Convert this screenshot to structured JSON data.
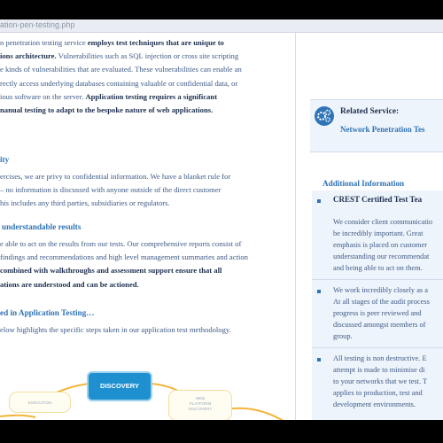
{
  "browser": {
    "url": "ation-pen-testing.php"
  },
  "main": {
    "intro": {
      "t1": "n penetration testing service ",
      "b1": "employs test techniques that are unique to",
      "b2": "ions architecture.",
      "t2": " Vulnerabilities such as SQL injection or cross site scripting",
      "l3": "e kinds of vulnerabilities that are evaluated. These vulnerabilities can enable an",
      "l4": "rectly access underlying databases containing valuable or confidential data, or",
      "l5a": "ious software on the server. ",
      "b5": "Application testing requires a significant",
      "b6": "nanual testing to adapt to the bespoke nature of web applications."
    },
    "confidentiality": {
      "heading": "ity",
      "l1": "ercises, we are privy to confidential information. We have a blanket rule for",
      "l2": " – no information is discussed with anyone outside of the direct customer",
      "l3": "his includes any third parties, subsidiaries or regulators."
    },
    "results": {
      "heading": "understandable results",
      "l1": "e able to act on the results from our tests. Our comprehensive reports consist of",
      "l2": "findings and recommendations and high level management summaries and action",
      "b3": "combined with walkthroughs and assessment support ensure that all",
      "b4": "ations are understood and can be actioned."
    },
    "steps": {
      "heading": "ed in Application Testing…",
      "l1": "elow highlights the specific steps taken in our application test methodology."
    },
    "diagram": {
      "discovery": "DISCOVERY",
      "left": "EXECUTION",
      "right": "WEB\nPLATFORM\nDISCOVERY"
    }
  },
  "sidebar": {
    "related_title": "Related Service:",
    "related_link": "Network Penetration Tes",
    "additional_heading": "Additional Information",
    "items": [
      {
        "title": "CREST Certified Test Tea",
        "lines": [
          "We consider client communicatio",
          "be incredibly important. Great",
          "emphasis is placed on customer",
          "understanding our recommendat",
          "and being able to act on them."
        ]
      },
      {
        "lines": [
          "We work incredibly closely as a",
          "At all stages of the audit process",
          "progress is peer reviewed and",
          "discussed amongst members of",
          "group."
        ]
      },
      {
        "lines": [
          "All testing is non destructive. E",
          "attempt is made to minimise di",
          "to your networks that we test. T",
          "applies to production, test and",
          "development environments."
        ]
      }
    ]
  },
  "colors": {
    "accent": "#2f74b5",
    "text": "#3e5a86",
    "strong_text": "#1e3050",
    "discovery": "#1e90d0"
  }
}
